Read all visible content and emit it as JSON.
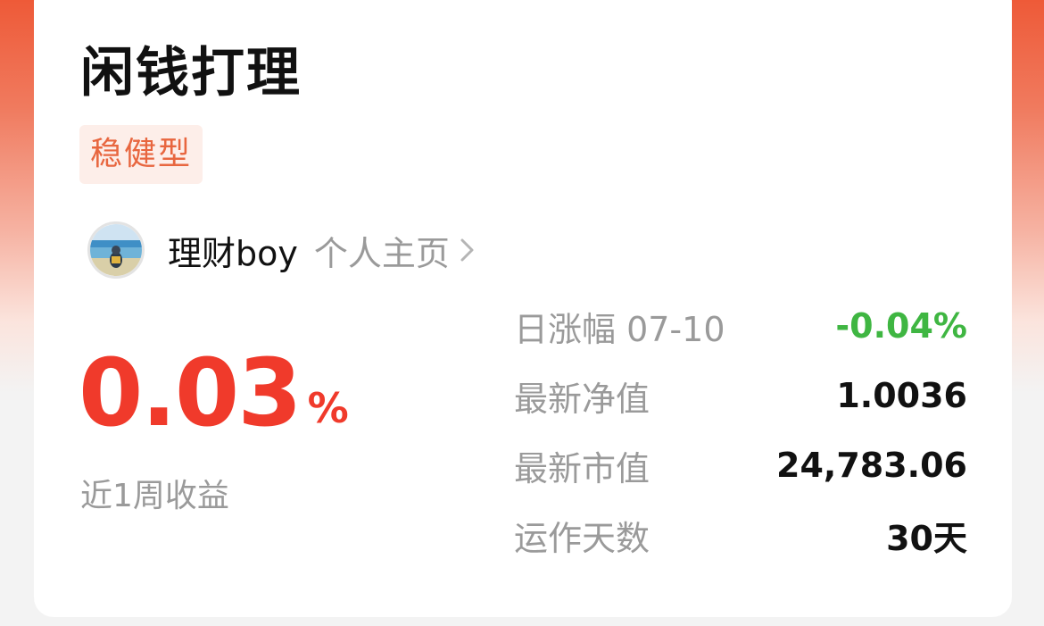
{
  "card": {
    "title": "闲钱打理",
    "tag": "稳健型"
  },
  "author": {
    "name": "理财boy",
    "link_label": "个人主页"
  },
  "weekly_return": {
    "value": "0.03",
    "unit": "%",
    "label": "近1周收益"
  },
  "stats": [
    {
      "label": "日涨幅 07-10",
      "value": "-0.04%"
    },
    {
      "label": "最新净值",
      "value": "1.0036"
    },
    {
      "label": "最新市值",
      "value": "24,783.06"
    },
    {
      "label": "运作天数",
      "value": "30天"
    }
  ],
  "colors": {
    "accent_red": "#f03a2b",
    "tag_orange": "#e8663f",
    "tag_bg": "#fdeee9",
    "negative_green": "#3fb642"
  },
  "icons": {
    "link_arrow": "chevron-right-icon"
  }
}
